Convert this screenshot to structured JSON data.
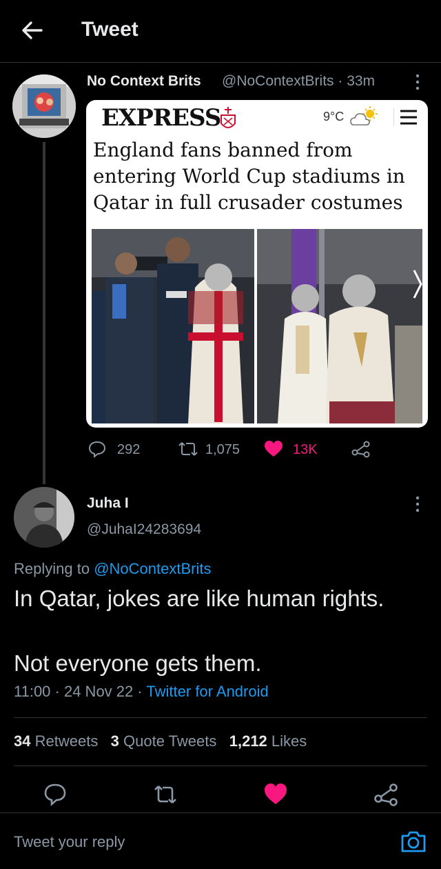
{
  "header": {
    "title": "Tweet",
    "back_icon": "back-arrow-icon"
  },
  "quoted_tweet": {
    "name": "No Context Brits",
    "handle_time": "@NoContextBrits · 33m",
    "embed": {
      "logo": "EXPRESS",
      "weather": "9°C",
      "headline": "England fans banned from entering World Cup stadiums in Qatar in full crusader costumes"
    },
    "stats": {
      "replies": "292",
      "retweets": "1,075",
      "likes": "13K"
    },
    "like_color": "#f91880"
  },
  "main_tweet": {
    "name": "Juha I",
    "handle": "@JuhaI24283694",
    "replying_prefix": "Replying to ",
    "replying_to": "@NoContextBrits",
    "text_line1": "In Qatar, jokes are like human rights.",
    "text_line2": "Not everyone gets them.",
    "time_date": "11:00 · 24 Nov 22 · ",
    "source": "Twitter for Android",
    "stats": {
      "retweets_count": "34",
      "retweets_label": "Retweets",
      "quotes_count": "3",
      "quotes_label": "Quote Tweets",
      "likes_count": "1,212",
      "likes_label": "Likes"
    }
  },
  "reply": {
    "placeholder": "Tweet your reply"
  },
  "colors": {
    "background": "#000000",
    "accent": "#1d9bf0",
    "like": "#f91880",
    "muted": "#8b98a5"
  }
}
